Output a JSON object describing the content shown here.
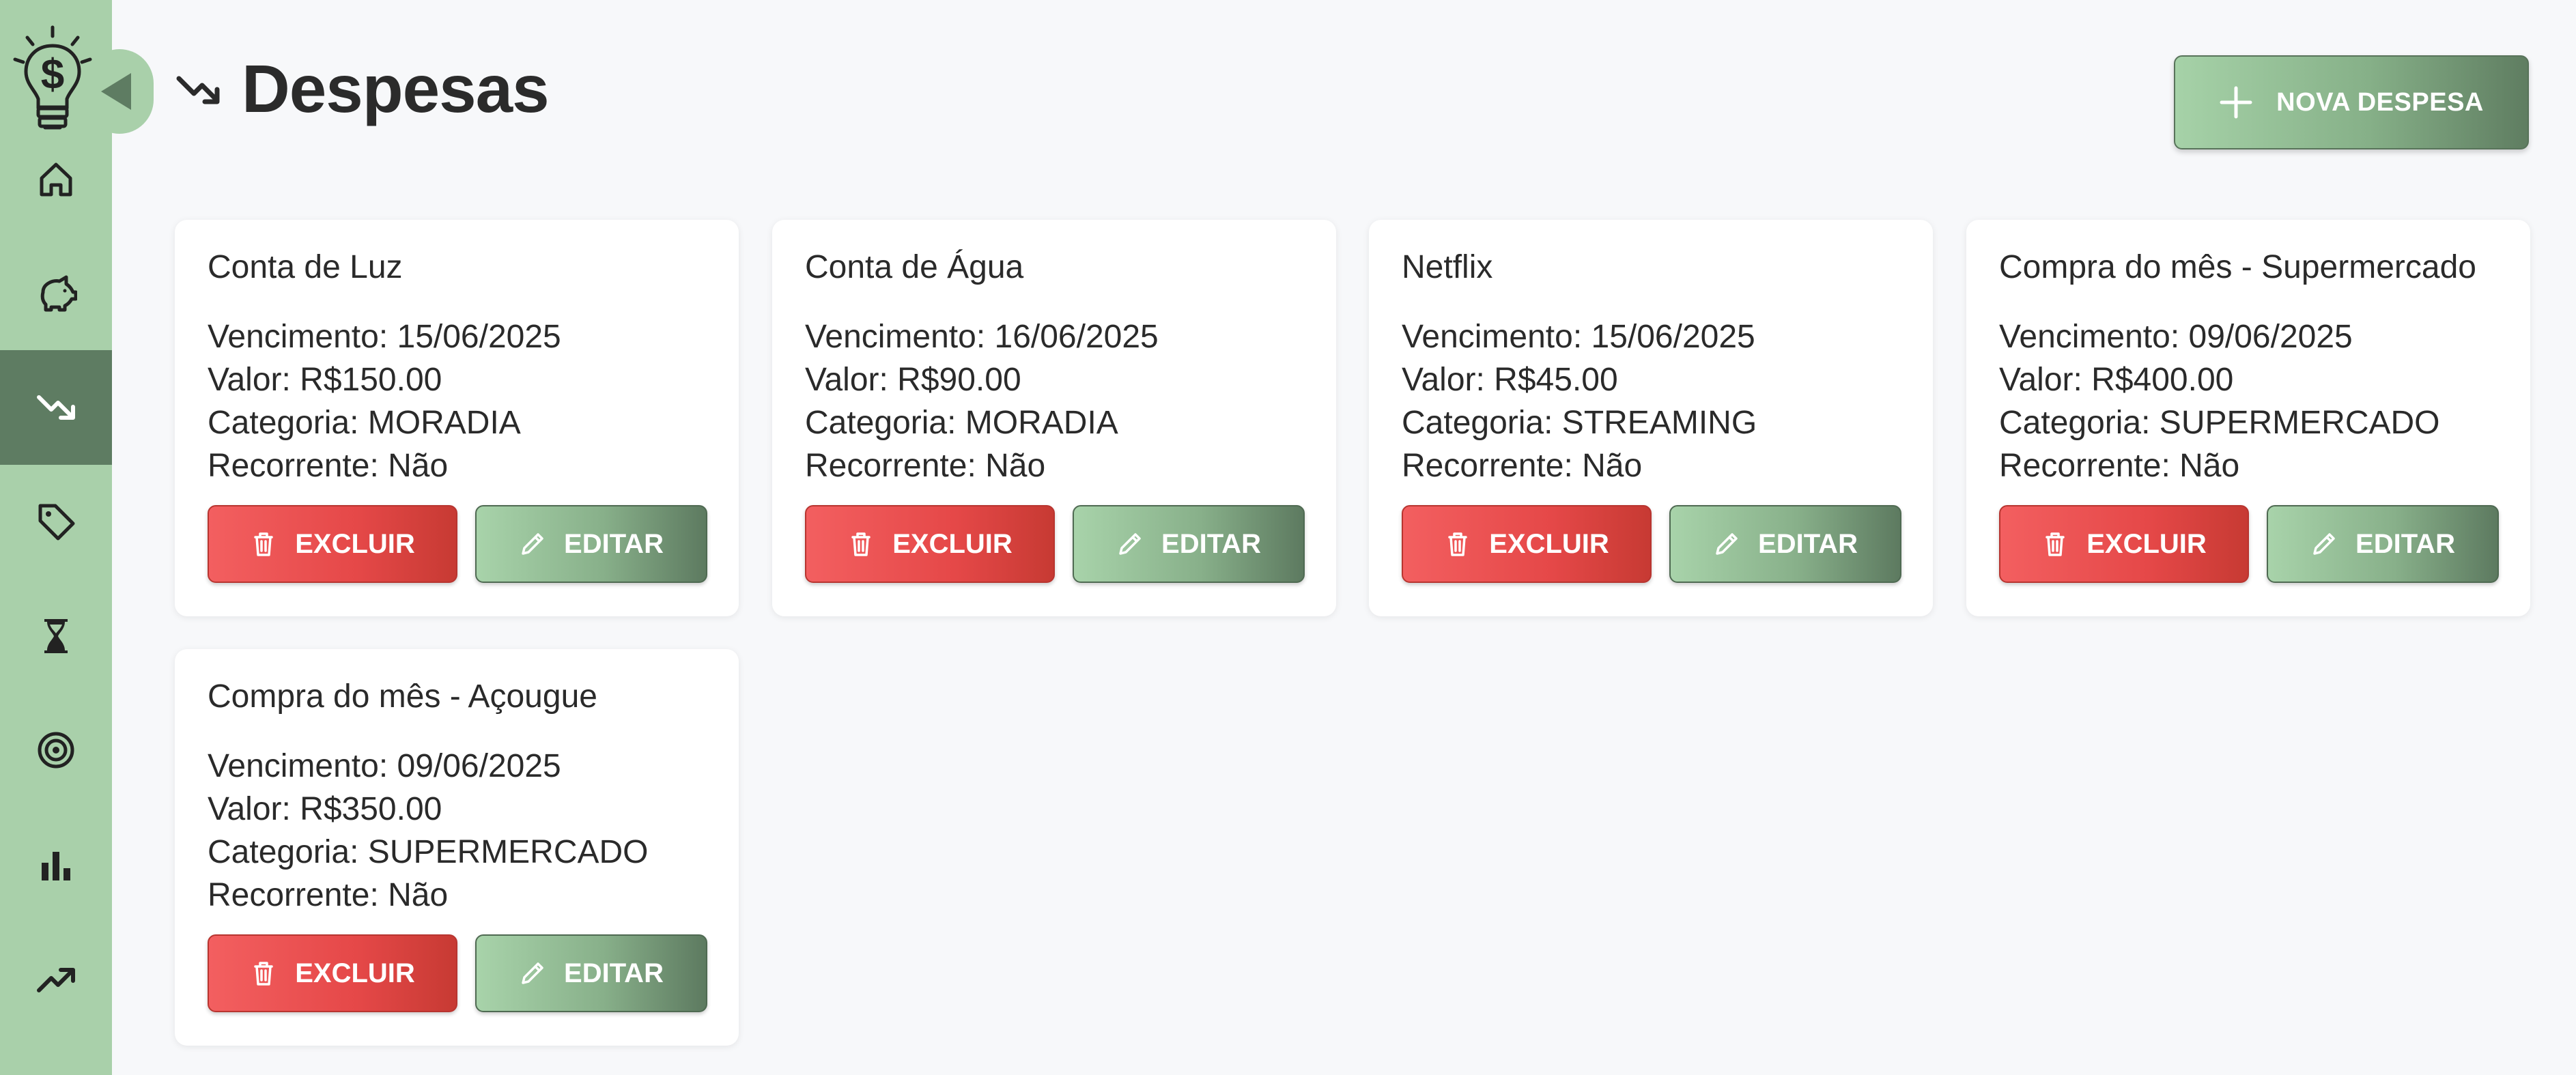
{
  "page": {
    "title": "Despesas",
    "new_button_label": "NOVA DESPESA"
  },
  "sidebar": {
    "items": [
      {
        "icon": "home-icon"
      },
      {
        "icon": "piggy-bank-icon"
      },
      {
        "icon": "trending-down-icon",
        "active": true
      },
      {
        "icon": "tag-icon"
      },
      {
        "icon": "hourglass-icon"
      },
      {
        "icon": "target-icon"
      },
      {
        "icon": "bar-chart-icon"
      },
      {
        "icon": "trending-up-icon"
      }
    ]
  },
  "labels": {
    "due": "Vencimento:",
    "value": "Valor:",
    "category": "Categoria:",
    "recurring": "Recorrente:",
    "delete": "EXCLUIR",
    "edit": "EDITAR"
  },
  "expenses": [
    {
      "title": "Conta de Luz",
      "due_line": "Vencimento: 15/06/2025",
      "value_line": "Valor: R$150.00",
      "category_line": "Categoria: MORADIA",
      "recurring_line": "Recorrente: Não"
    },
    {
      "title": "Conta de Água",
      "due_line": "Vencimento: 16/06/2025",
      "value_line": "Valor: R$90.00",
      "category_line": "Categoria: MORADIA",
      "recurring_line": "Recorrente: Não"
    },
    {
      "title": "Netflix",
      "due_line": "Vencimento: 15/06/2025",
      "value_line": "Valor: R$45.00",
      "category_line": "Categoria: STREAMING",
      "recurring_line": "Recorrente: Não"
    },
    {
      "title": "Compra do mês - Supermercado",
      "due_line": "Vencimento: 09/06/2025",
      "value_line": "Valor: R$400.00",
      "category_line": "Categoria: SUPERMERCADO",
      "recurring_line": "Recorrente: Não"
    },
    {
      "title": "Compra do mês - Açougue",
      "due_line": "Vencimento: 09/06/2025",
      "value_line": "Valor: R$350.00",
      "category_line": "Categoria: SUPERMERCADO",
      "recurring_line": "Recorrente: Não"
    }
  ],
  "colors": {
    "sidebar": "#a9d0aa",
    "sidebar_active": "#5e7c62",
    "delete": "#e54848",
    "edit": "#88b08a"
  }
}
